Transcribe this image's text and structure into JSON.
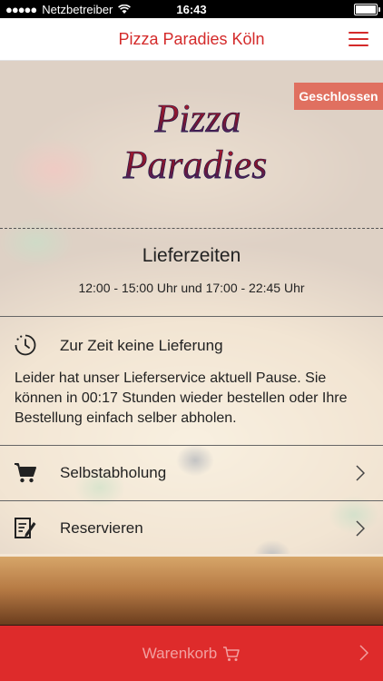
{
  "status_bar": {
    "carrier": "Netzbetreiber",
    "time": "16:43"
  },
  "navbar": {
    "title": "Pizza Paradies Köln"
  },
  "badge": "Geschlossen",
  "logo": {
    "line1": "Pizza",
    "line2": "Paradies"
  },
  "delivery": {
    "title": "Lieferzeiten",
    "hours": "12:00 - 15:00 Uhr und 17:00 - 22:45 Uhr"
  },
  "notice": {
    "title": "Zur Zeit keine Lieferung",
    "text": "Leider hat unser Lieferservice aktuell Pause. Sie können in 00:17 Stunden wieder bestellen oder Ihre Bestellung einfach selber abholen."
  },
  "actions": {
    "pickup": "Selbstabholung",
    "reserve": "Reservieren"
  },
  "cart": {
    "label": "Warenkorb"
  },
  "colors": {
    "accent": "#de2b2b",
    "badge": "#e07060"
  }
}
